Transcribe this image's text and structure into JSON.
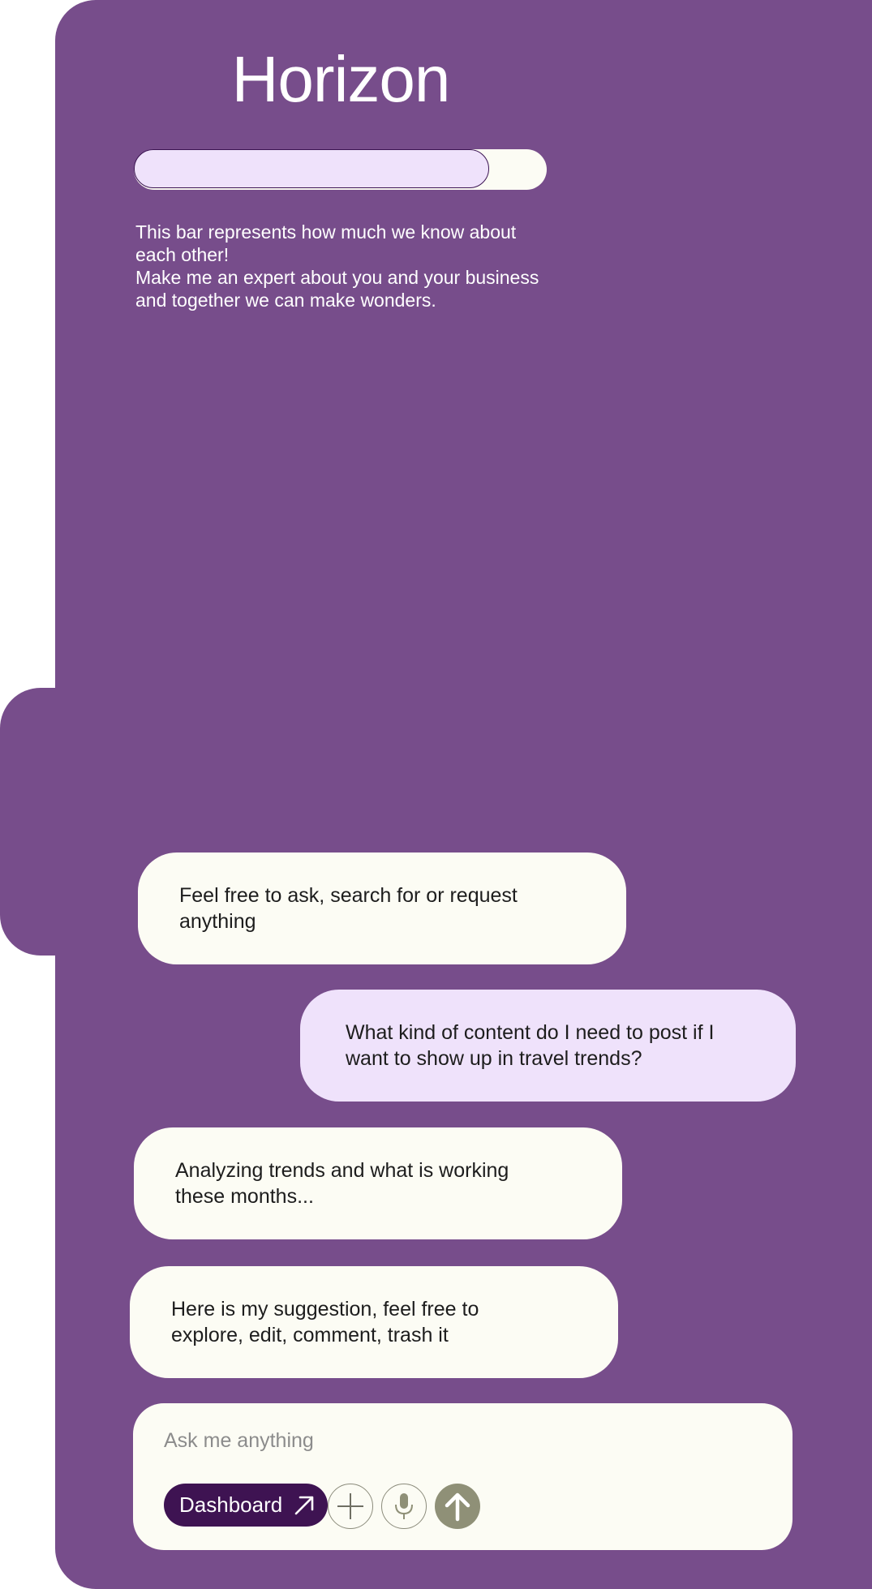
{
  "app": {
    "title": "Horizon"
  },
  "knowledge_bar": {
    "progress_fraction": 0.86,
    "description_line1": "This bar represents how much we know about each other!",
    "description_line2": "Make me an expert about you and your business and together we can make wonders."
  },
  "chat": {
    "messages": [
      {
        "role": "assistant",
        "text": "Feel free to ask, search for or request anything"
      },
      {
        "role": "user",
        "text": "What kind of content do I need to post if I want to show up in travel trends?"
      },
      {
        "role": "assistant",
        "text": "Analyzing trends and what is working these months..."
      },
      {
        "role": "assistant",
        "text": "Here is my suggestion, feel free to explore, edit, comment, trash it"
      }
    ]
  },
  "composer": {
    "placeholder": "Ask me anything",
    "dashboard_label": "Dashboard",
    "icons": {
      "dashboard": "arrow-up-right-icon",
      "attach": "plus-icon",
      "voice": "microphone-icon",
      "send": "arrow-up-icon"
    }
  },
  "colors": {
    "panel": "#774d8b",
    "bubble_assistant": "#fcfcf4",
    "bubble_user": "#efe2fb",
    "dashboard_button": "#3e1352",
    "send_button": "#8f9077"
  }
}
